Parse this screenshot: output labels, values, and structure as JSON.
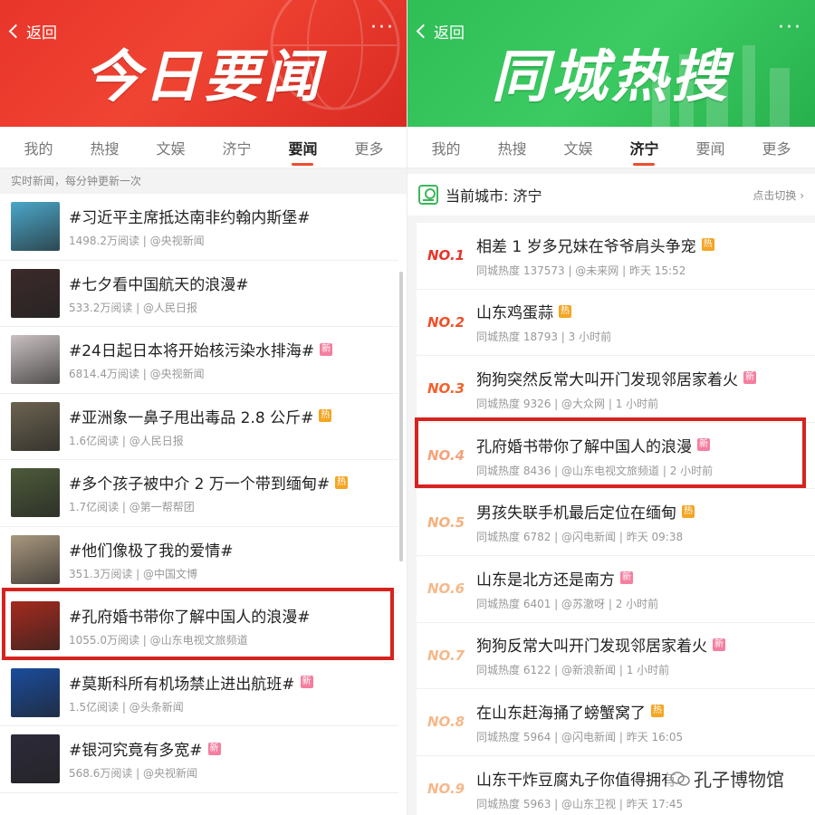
{
  "left": {
    "back_label": "返回",
    "more_label": "···",
    "hero_title": "今日要闻",
    "tabs": [
      {
        "label": "我的",
        "active": false
      },
      {
        "label": "热搜",
        "active": false
      },
      {
        "label": "文娱",
        "active": false
      },
      {
        "label": "济宁",
        "active": false
      },
      {
        "label": "要闻",
        "active": true
      },
      {
        "label": "更多",
        "active": false
      }
    ],
    "sub_note": "实时新闻，每分钟更新一次",
    "items": [
      {
        "title": "#习近平主席抵达南非约翰内斯堡#",
        "meta": "1498.2万阅读 | @央视新闻",
        "badge": "",
        "thumb_color": "#4aa7c9"
      },
      {
        "title": "#七夕看中国航天的浪漫#",
        "meta": "533.2万阅读 | @人民日报",
        "badge": "",
        "thumb_color": "#3b2a2a"
      },
      {
        "title": "#24日起日本将开始核污染水排海#",
        "meta": "6814.4万阅读 | @央视新闻",
        "badge": "新",
        "badge_type": "new",
        "thumb_color": "#c9c0c0"
      },
      {
        "title": "#亚洲象一鼻子甩出毒品 2.8 公斤#",
        "meta": "1.6亿阅读 | @人民日报",
        "badge": "热",
        "badge_type": "hot",
        "thumb_color": "#6b6350"
      },
      {
        "title": "#多个孩子被中介 2 万一个带到缅甸#",
        "meta": "1.7亿阅读 | @第一帮帮团",
        "badge": "热",
        "badge_type": "hot",
        "thumb_color": "#4d5a3a"
      },
      {
        "title": "#他们像极了我的爱情#",
        "meta": "351.3万阅读 | @中国文博",
        "badge": "",
        "thumb_color": "#a8977e"
      },
      {
        "title": "#孔府婚书带你了解中国人的浪漫#",
        "meta": "1055.0万阅读 | @山东电视文旅频道",
        "badge": "",
        "thumb_color": "#a52a1e"
      },
      {
        "title": "#莫斯科所有机场禁止进出航班#",
        "meta": "1.5亿阅读 | @头条新闻",
        "badge": "新",
        "badge_type": "new",
        "thumb_color": "#1a4c9c"
      },
      {
        "title": "#银河究竟有多宽#",
        "meta": "568.6万阅读 | @央视新闻",
        "badge": "新",
        "badge_type": "new",
        "thumb_color": "#2d2a3a"
      }
    ]
  },
  "right": {
    "back_label": "返回",
    "more_label": "···",
    "hero_title": "同城热搜",
    "tabs": [
      {
        "label": "我的",
        "active": false
      },
      {
        "label": "热搜",
        "active": false
      },
      {
        "label": "文娱",
        "active": false
      },
      {
        "label": "济宁",
        "active": true
      },
      {
        "label": "要闻",
        "active": false
      },
      {
        "label": "更多",
        "active": false
      }
    ],
    "city_label": "当前城市: 济宁",
    "switch_label": "点击切换 ›",
    "items": [
      {
        "rank": "NO.1",
        "title": "相差 1 岁多兄妹在爷爷肩头争宠",
        "meta": "同城热度 137573 | @未来网 | 昨天 15:52",
        "badge": "热",
        "badge_type": "hot",
        "rank_color": "#e8352a"
      },
      {
        "rank": "NO.2",
        "title": "山东鸡蛋蒜",
        "meta": "同城热度 18793 | 3 小时前",
        "badge": "热",
        "badge_type": "hot",
        "rank_color": "#f04f2b"
      },
      {
        "rank": "NO.3",
        "title": "狗狗突然反常大叫开门发现邻居家着火",
        "meta": "同城热度 9326 | @大众网 | 1 小时前",
        "badge": "新",
        "badge_type": "new",
        "rank_color": "#f2612c"
      },
      {
        "rank": "NO.4",
        "title": "孔府婚书带你了解中国人的浪漫",
        "meta": "同城热度 8436 | @山东电视文旅频道 | 2 小时前",
        "badge": "新",
        "badge_type": "new",
        "rank_color": "#f5a37a"
      },
      {
        "rank": "NO.5",
        "title": "男孩失联手机最后定位在缅甸",
        "meta": "同城热度 6782 | @闪电新闻 | 昨天 09:38",
        "badge": "热",
        "badge_type": "hot",
        "rank_color": "#f5b07e"
      },
      {
        "rank": "NO.6",
        "title": "山东是北方还是南方",
        "meta": "同城热度 6401 | @苏澈呀 | 2 小时前",
        "badge": "新",
        "badge_type": "new",
        "rank_color": "#f5b88a"
      },
      {
        "rank": "NO.7",
        "title": "狗狗反常大叫开门发现邻居家着火",
        "meta": "同城热度 6122 | @新浪新闻 | 1 小时前",
        "badge": "新",
        "badge_type": "new",
        "rank_color": "#f5b88a"
      },
      {
        "rank": "NO.8",
        "title": "在山东赶海捅了螃蟹窝了",
        "meta": "同城热度 5964 | @闪电新闻 | 昨天 16:05",
        "badge": "热",
        "badge_type": "hot",
        "rank_color": "#f5b88a"
      },
      {
        "rank": "NO.9",
        "title": "山东干炸豆腐丸子你值得拥有",
        "meta": "同城热度 5963 | @山东卫视 | 昨天 17:45",
        "badge": "",
        "rank_color": "#f5b88a"
      }
    ]
  },
  "watermark": {
    "text": "孔子博物馆"
  }
}
